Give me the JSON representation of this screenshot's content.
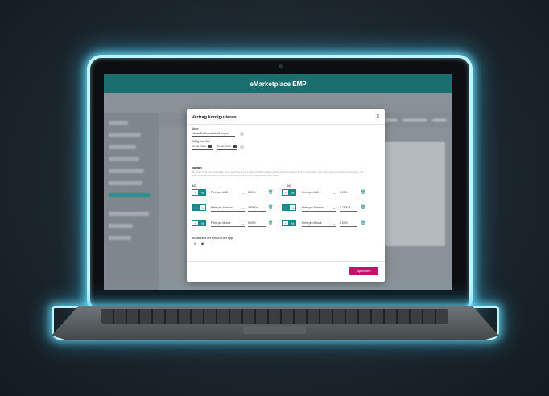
{
  "app": {
    "title": "eMarketplace EMP"
  },
  "modal": {
    "title": "Vertrag konfigurieren",
    "name_label": "Name",
    "name_value": "Neuer Endkundentarif August",
    "valid_label": "Gültig von / bis",
    "date_from": "10.08.2021",
    "date_to": "31.12.9999",
    "tarif_title": "Tarifart",
    "description": "Wir bieten Ihnen die Möglichkeit, einen Zuschlag auf den Preis des EMP-Anbieters bzw. auf Ihren eigenen Tarif zu berechnen, oder einen eigenen Festpreis festzulegen. Mit einem Zuschlag wird der vom EMP berechnete Preis um den angegebenen Wert erhöht.",
    "ac_label": "AC",
    "dc_label": "DC",
    "rows": [
      {
        "ac_type": "Preis pro kWh",
        "ac_value": "5,00%",
        "dc_type": "Preis pro kWh",
        "dc_value": "5,00%"
      },
      {
        "ac_type": "Preis pro Session",
        "ac_value": "0,5000 €",
        "dc_type": "Preis pro Session",
        "dc_value": "0,7500 €"
      },
      {
        "ac_type": "Preis pro Minute",
        "ac_value": "5,00%",
        "dc_type": "Preis pro Minute",
        "dc_value": "5,00%"
      }
    ],
    "visibility_label": "Sichtbarkeit der Preise in der App",
    "save_label": "Speichern",
    "close_glyph": "×",
    "plus_glyph": "+",
    "percent_glyph": "%",
    "euro_glyph": "€",
    "info_glyph": "i"
  },
  "icons": [
    "close-icon",
    "info-icon",
    "calendar-icon",
    "chevron-down-icon",
    "trash-icon",
    "eye-icon",
    "eye-off-icon"
  ],
  "colors": {
    "accent": "#178a8c",
    "header": "#1b6e6e",
    "save": "#c0136e",
    "glow": "#bff3ff"
  }
}
